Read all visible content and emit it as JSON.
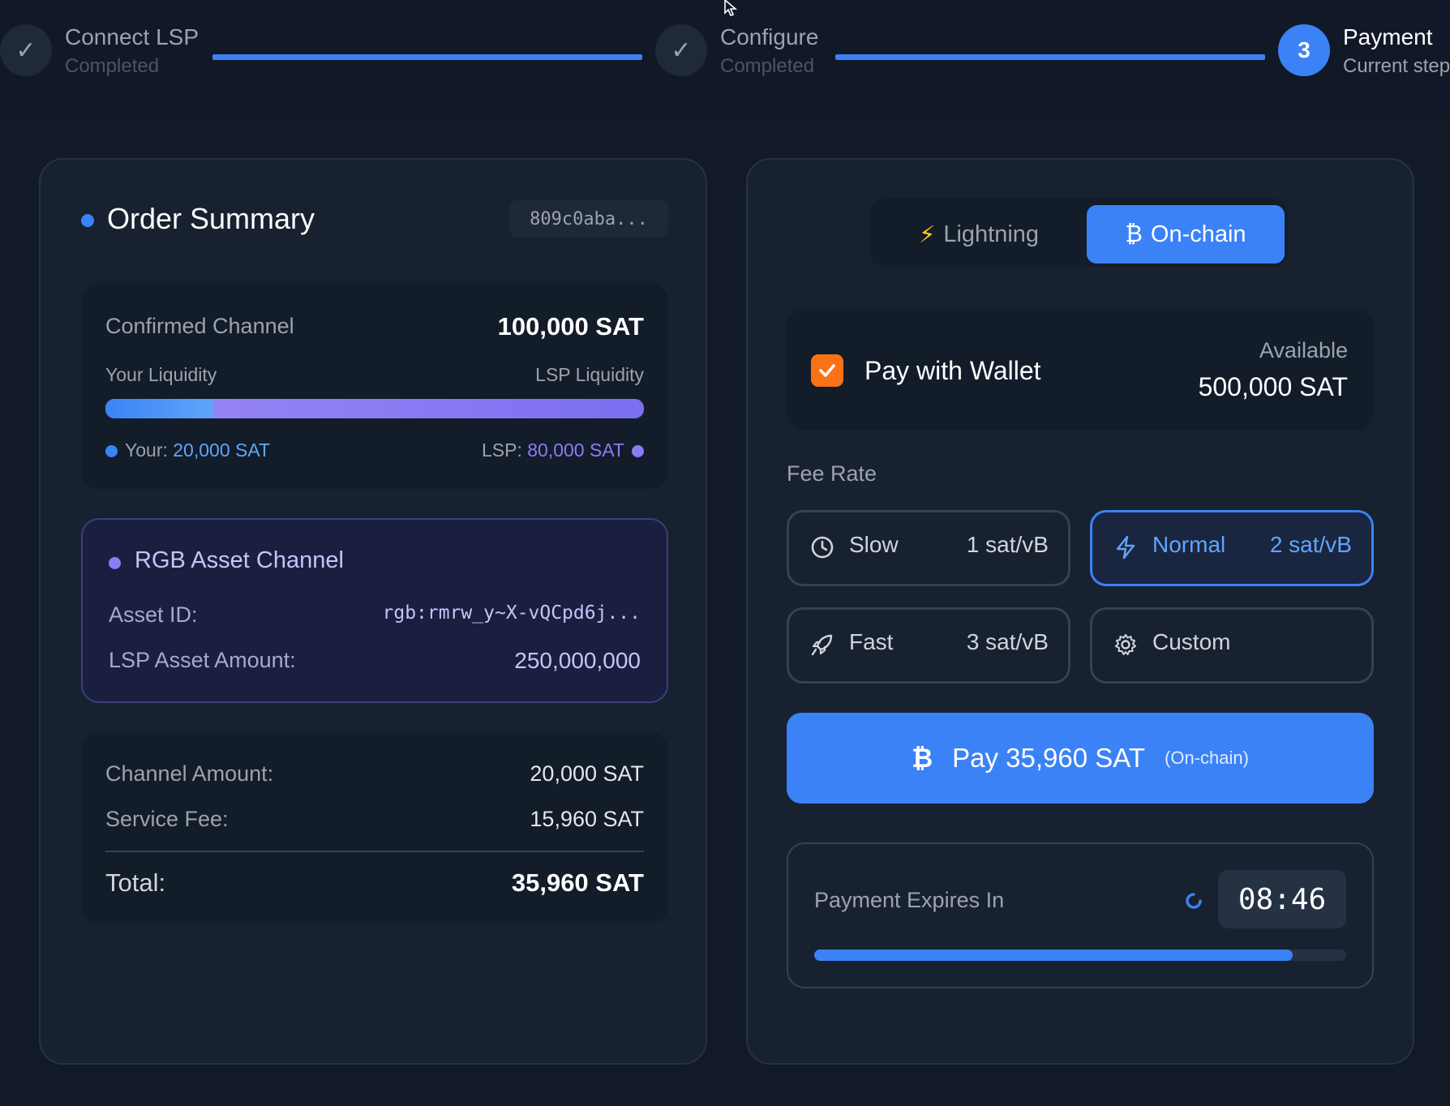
{
  "stepper": {
    "steps": [
      {
        "title": "Connect LSP",
        "subtitle": "Completed",
        "state": "done",
        "mark": "✓"
      },
      {
        "title": "Configure",
        "subtitle": "Completed",
        "state": "done",
        "mark": "✓"
      },
      {
        "title": "Payment",
        "subtitle": "Current step",
        "state": "current",
        "mark": "3"
      }
    ]
  },
  "order_summary": {
    "title": "Order Summary",
    "order_id": "809c0aba...",
    "confirmed_channel_label": "Confirmed Channel",
    "confirmed_channel_value": "100,000 SAT",
    "your_liquidity_label": "Your Liquidity",
    "lsp_liquidity_label": "LSP Liquidity",
    "your_liquidity_fraction": 0.2,
    "your_prefix": "Your:",
    "your_amount": "20,000 SAT",
    "lsp_prefix": "LSP:",
    "lsp_amount": "80,000 SAT",
    "rgb": {
      "title": "RGB Asset Channel",
      "asset_id_label": "Asset ID:",
      "asset_id_value": "rgb:rmrw_y~X-vQCpd6j...",
      "lsp_asset_amount_label": "LSP Asset Amount:",
      "lsp_asset_amount_value": "250,000,000"
    },
    "channel_amount_label": "Channel Amount:",
    "channel_amount_value": "20,000 SAT",
    "service_fee_label": "Service Fee:",
    "service_fee_value": "15,960 SAT",
    "total_label": "Total:",
    "total_value": "35,960 SAT"
  },
  "payment": {
    "tabs": [
      {
        "icon": "⚡",
        "label": "Lightning",
        "active": false
      },
      {
        "icon": "₿",
        "label": "On-chain",
        "active": true
      }
    ],
    "wallet": {
      "checked": true,
      "label": "Pay with Wallet",
      "available_label": "Available",
      "available_value": "500,000 SAT"
    },
    "fee_rate_label": "Fee Rate",
    "fees": [
      {
        "name": "Slow",
        "rate": "1 sat/vB",
        "icon": "clock-icon",
        "active": false
      },
      {
        "name": "Normal",
        "rate": "2 sat/vB",
        "icon": "lightning-icon",
        "active": true
      },
      {
        "name": "Fast",
        "rate": "3 sat/vB",
        "icon": "rocket-icon",
        "active": false
      },
      {
        "name": "Custom",
        "rate": "",
        "icon": "gear-icon",
        "active": false
      }
    ],
    "pay_button": {
      "icon": "₿",
      "label": "Pay 35,960 SAT",
      "suffix": "(On-chain)"
    },
    "expiry": {
      "label": "Payment Expires In",
      "time": "08:46",
      "progress": 0.9
    }
  },
  "colors": {
    "accent": "#3b82f6",
    "purple": "#8b7cf6",
    "orange": "#f97316"
  }
}
